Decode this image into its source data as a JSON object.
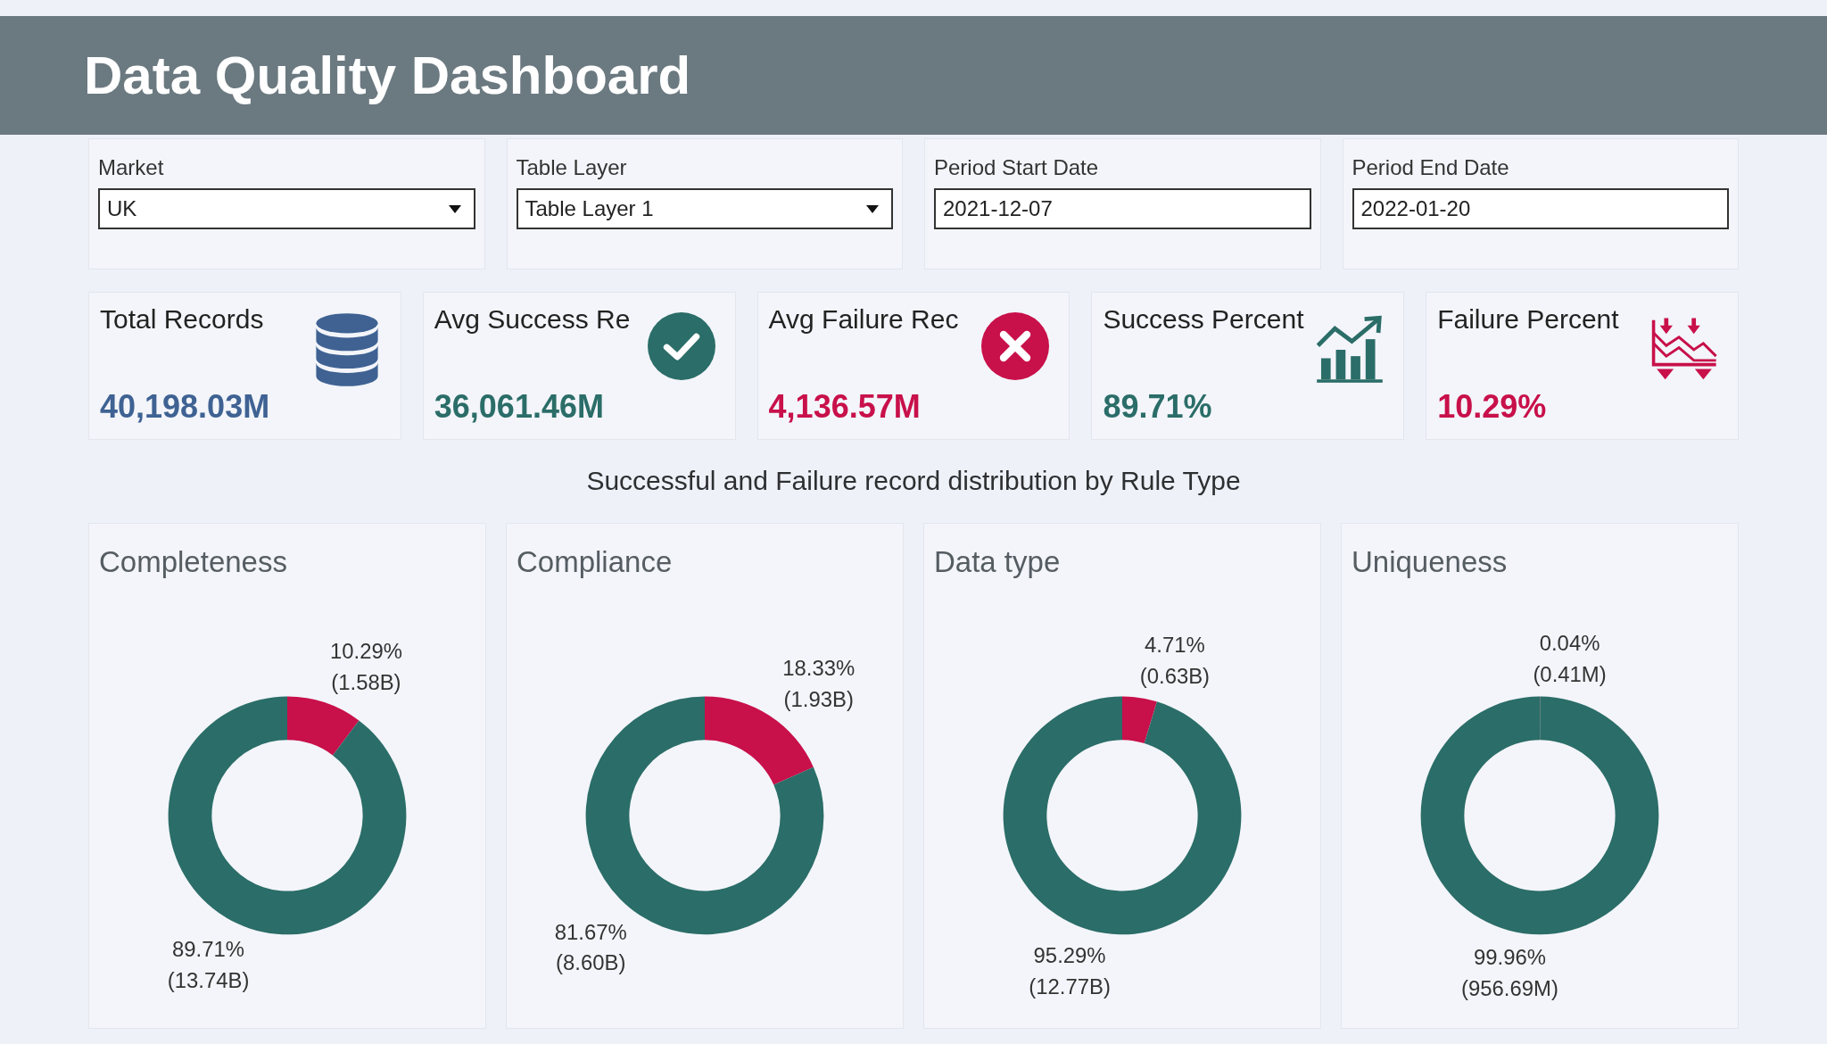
{
  "header": {
    "title": "Data Quality Dashboard"
  },
  "filters": [
    {
      "label": "Market",
      "kind": "dropdown",
      "value": "UK"
    },
    {
      "label": "Table Layer",
      "kind": "dropdown",
      "value": "Table Layer 1"
    },
    {
      "label": "Period Start Date",
      "kind": "date",
      "value": "2021-12-07"
    },
    {
      "label": "Period End Date",
      "kind": "date",
      "value": "2022-01-20"
    }
  ],
  "kpis": [
    {
      "title": "Total Records",
      "kind": "total",
      "value": "40,198.03M",
      "color": "#3f6293"
    },
    {
      "title": "Avg Success Re",
      "kind": "success_count",
      "value": "36,061.46M",
      "color": "#2b6d68"
    },
    {
      "title": "Avg Failure Rec",
      "kind": "failure_count",
      "value": "4,136.57M",
      "color": "#c8104a"
    },
    {
      "title": "Success Percent",
      "kind": "success_rate",
      "value": "89.71%",
      "color": "#2b6d68"
    },
    {
      "title": "Failure Percent",
      "kind": "failure_rate",
      "value": "10.29%",
      "color": "#c8104a"
    }
  ],
  "distribution": {
    "title": "Successful and Failure record distribution by Rule Type",
    "charts": [
      {
        "chart_data": {
          "type": "donut",
          "title": "Completeness",
          "values": [
            10.29,
            89.71
          ],
          "colors": [
            "#c8104a",
            "#2b6d68"
          ],
          "value_labels": [
            "10.29%\n(1.58B)",
            "89.71%\n(13.74B)"
          ]
        }
      },
      {
        "chart_data": {
          "type": "donut",
          "title": "Compliance",
          "values": [
            18.33,
            81.67
          ],
          "colors": [
            "#c8104a",
            "#2b6d68"
          ],
          "value_labels": [
            "18.33%\n(1.93B)",
            "81.67%\n(8.60B)"
          ]
        }
      },
      {
        "chart_data": {
          "type": "donut",
          "title": "Data type",
          "values": [
            4.71,
            95.29
          ],
          "colors": [
            "#c8104a",
            "#2b6d68"
          ],
          "value_labels": [
            "4.71%\n(0.63B)",
            "95.29%\n(12.77B)"
          ]
        }
      },
      {
        "chart_data": {
          "type": "donut",
          "title": "Uniqueness",
          "values": [
            0.04,
            99.96
          ],
          "colors": [
            "#c8104a",
            "#2b6d68"
          ],
          "value_labels": [
            "0.04%\n(0.41M)",
            "99.96%\n(956.69M)"
          ]
        }
      }
    ]
  }
}
